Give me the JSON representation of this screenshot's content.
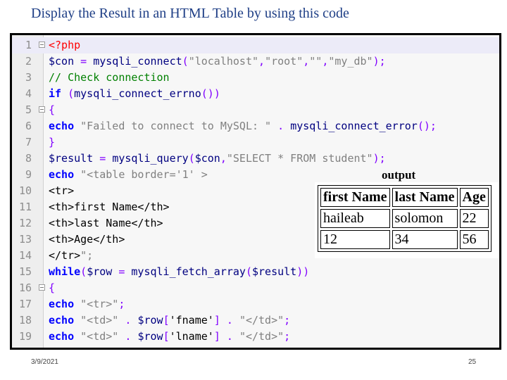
{
  "slide": {
    "title": "Display the Result in an HTML Table by using this code",
    "date": "3/9/2021",
    "page_number": "25"
  },
  "code_lines": [
    {
      "n": "1",
      "t": "<?php"
    },
    {
      "n": "2",
      "t": "$con = mysqli_connect(\"localhost\",\"root\",\"\",\"my_db\");"
    },
    {
      "n": "3",
      "t": "// Check connection"
    },
    {
      "n": "4",
      "t": "if (mysqli_connect_errno())"
    },
    {
      "n": "5",
      "t": "{"
    },
    {
      "n": "6",
      "t": "echo \"Failed to connect to MySQL: \" . mysqli_connect_error();"
    },
    {
      "n": "7",
      "t": "}"
    },
    {
      "n": "8",
      "t": "$result = mysqli_query($con,\"SELECT * FROM student\");"
    },
    {
      "n": "9",
      "t": "echo \"<table border='1' >"
    },
    {
      "n": "10",
      "t": "<tr>"
    },
    {
      "n": "11",
      "t": "<th>first Name</th>"
    },
    {
      "n": "12",
      "t": "<th>last Name</th>"
    },
    {
      "n": "13",
      "t": "<th>Age</th>"
    },
    {
      "n": "14",
      "t": "</tr>\";"
    },
    {
      "n": "15",
      "t": "while($row = mysqli_fetch_array($result))"
    },
    {
      "n": "16",
      "t": "{"
    },
    {
      "n": "17",
      "t": "echo \"<tr>\";"
    },
    {
      "n": "18",
      "t": "echo \"<td>\" . $row['fname'] . \"</td>\";"
    },
    {
      "n": "19",
      "t": "echo \"<td>\" . $row['lname'] . \"</td>\";"
    }
  ],
  "output": {
    "label": "output",
    "headers": [
      "first Name",
      "last Name",
      "Age"
    ],
    "rows": [
      [
        "haileab",
        "solomon",
        "22"
      ],
      [
        "12",
        "34",
        "56"
      ]
    ]
  }
}
